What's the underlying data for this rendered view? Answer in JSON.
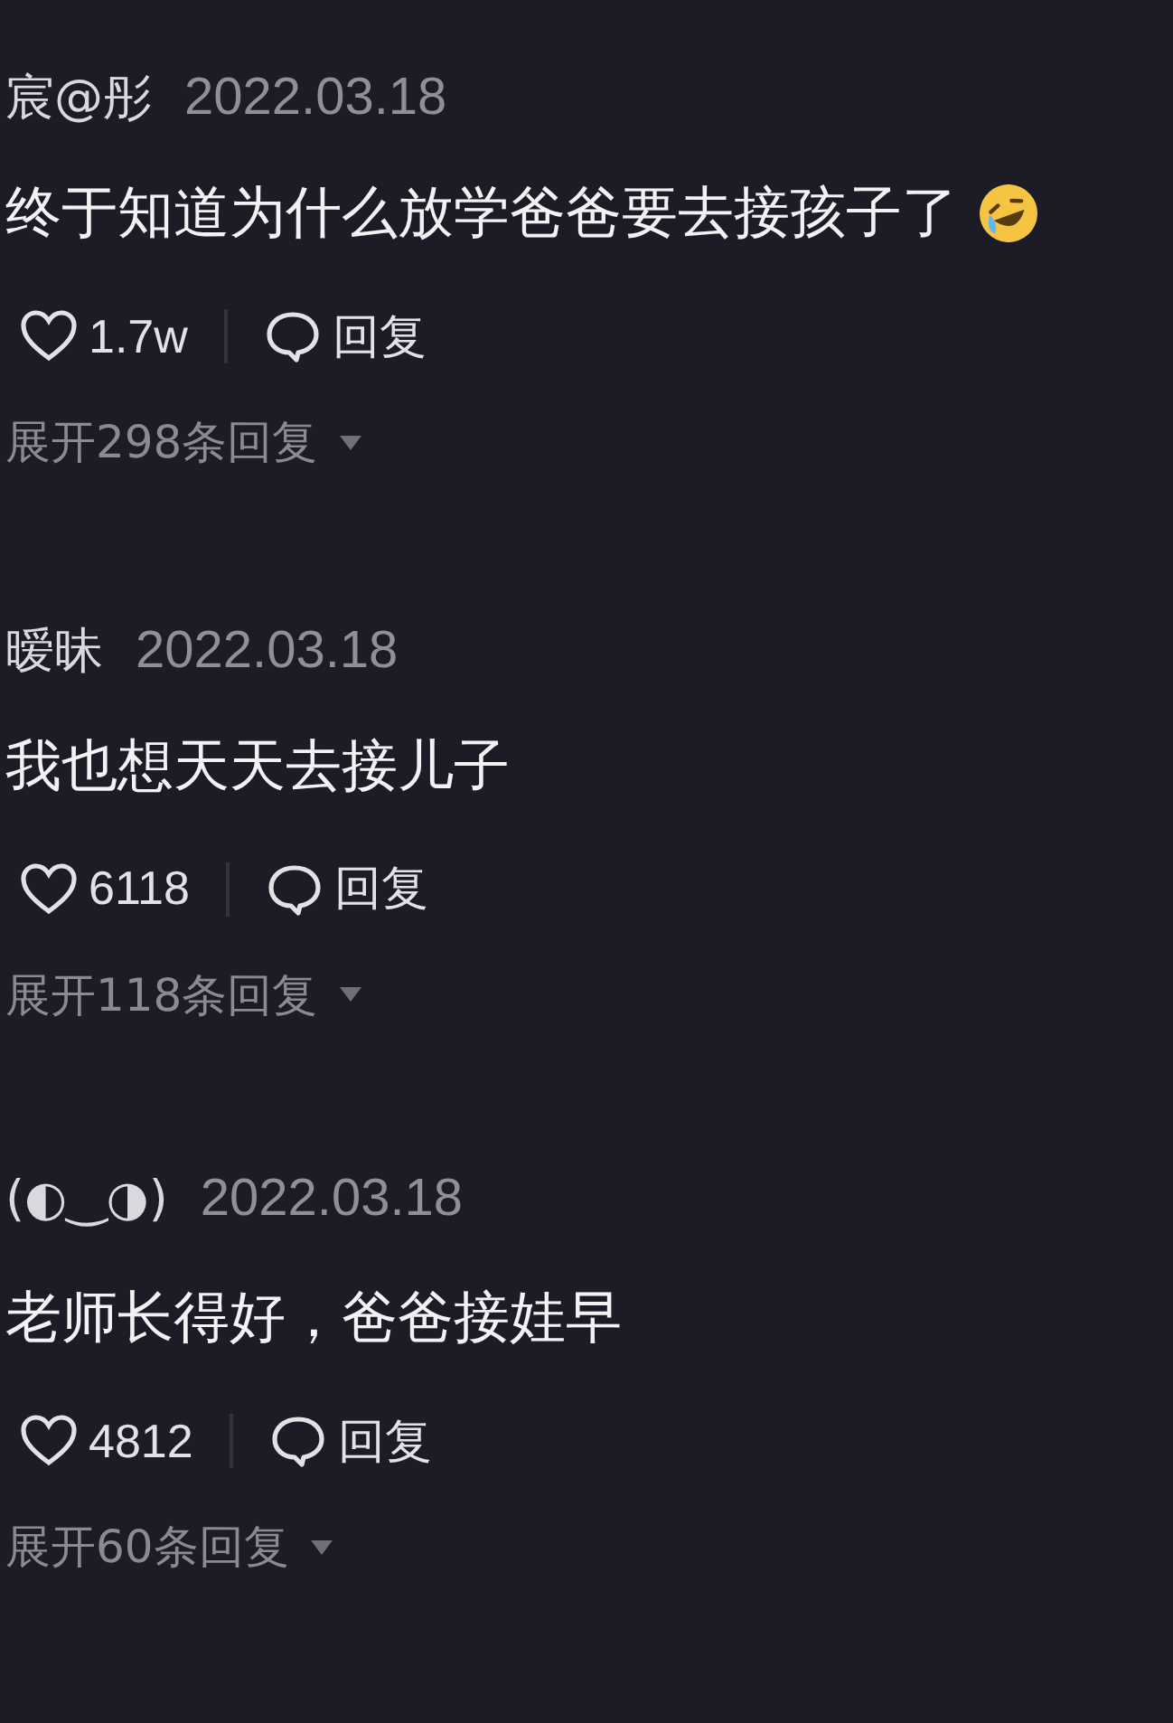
{
  "comments": [
    {
      "user": "宸@彤",
      "date": "2022.03.18",
      "text": "终于知道为什么放学爸爸要去接孩子了",
      "emoji": true,
      "likes": "1.7w",
      "liked": false,
      "reply": "回复",
      "expand": "展开298条回复"
    },
    {
      "user": "暧昧",
      "date": "2022.03.18",
      "text": "我也想天天去接儿子",
      "emoji": false,
      "likes": "6118",
      "liked": false,
      "reply": "回复",
      "expand": "展开118条回复"
    },
    {
      "user": "(◐‿◑)",
      "date": "2022.03.18",
      "text": "老师长得好，爸爸接娃早",
      "emoji": false,
      "likes": "4812",
      "liked": false,
      "reply": "回复",
      "expand": "展开60条回复"
    }
  ]
}
